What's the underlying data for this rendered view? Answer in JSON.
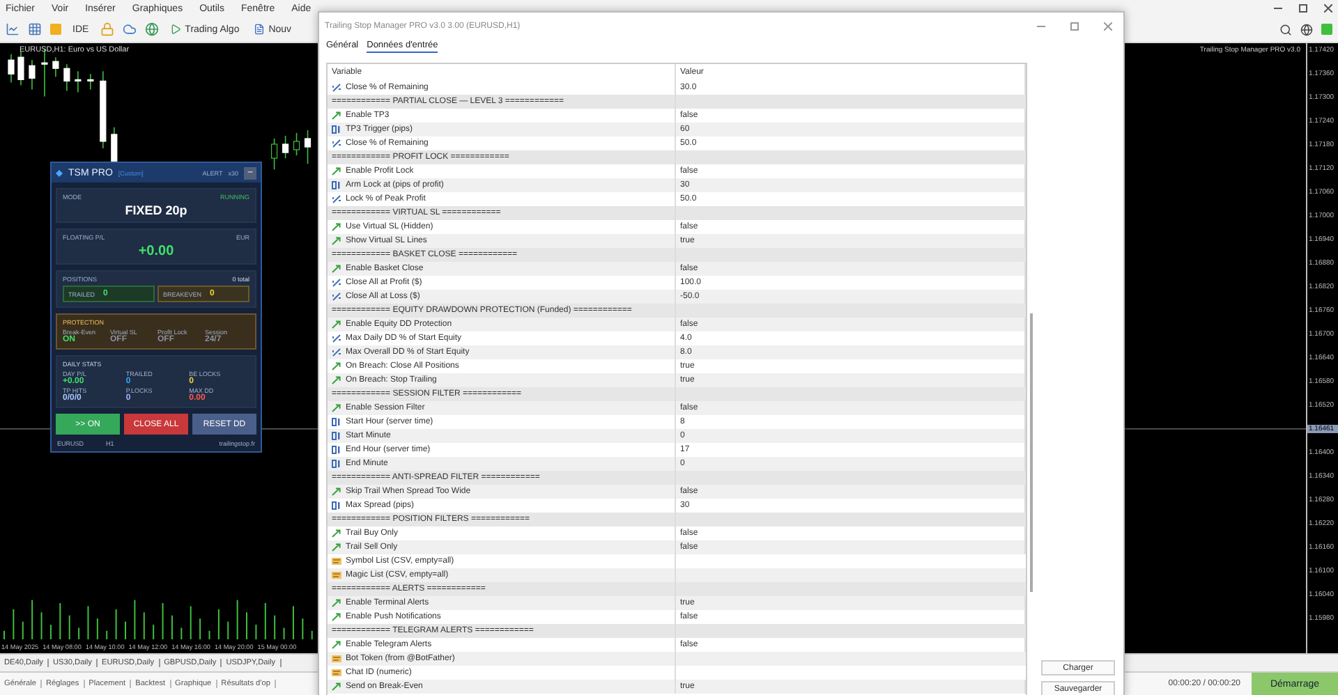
{
  "app": {
    "menu": [
      "Fichier",
      "Voir",
      "Insérer",
      "Graphiques",
      "Outils",
      "Fenêtre",
      "Aide"
    ],
    "toolbar": {
      "ide": "IDE",
      "algo": "Trading Algo",
      "new": "Nouv"
    },
    "chart": {
      "title": "EURUSD,H1: Euro vs US Dollar",
      "indicator": "Trailing Stop Manager PRO v3.0",
      "price_labels": [
        {
          "text": "1.17420",
          "current": false
        },
        {
          "text": "1.17360",
          "current": false
        },
        {
          "text": "1.17300",
          "current": false
        },
        {
          "text": "1.17240",
          "current": false
        },
        {
          "text": "1.17180",
          "current": false
        },
        {
          "text": "1.17120",
          "current": false
        },
        {
          "text": "1.17060",
          "current": false
        },
        {
          "text": "1.17000",
          "current": false
        },
        {
          "text": "1.16940",
          "current": false
        },
        {
          "text": "1.16880",
          "current": false
        },
        {
          "text": "1.16820",
          "current": false
        },
        {
          "text": "1.16760",
          "current": false
        },
        {
          "text": "1.16700",
          "current": false
        },
        {
          "text": "1.16640",
          "current": false
        },
        {
          "text": "1.16580",
          "current": false
        },
        {
          "text": "1.16520",
          "current": false
        },
        {
          "text": "1.16461",
          "current": true
        },
        {
          "text": "1.16400",
          "current": false
        },
        {
          "text": "1.16340",
          "current": false
        },
        {
          "text": "1.16280",
          "current": false
        },
        {
          "text": "1.16220",
          "current": false
        },
        {
          "text": "1.16160",
          "current": false
        },
        {
          "text": "1.16100",
          "current": false
        },
        {
          "text": "1.16040",
          "current": false
        },
        {
          "text": "1.15980",
          "current": false
        }
      ],
      "time_labels": [
        "14 May 2025",
        "14 May 08:00",
        "14 May 10:00",
        "14 May 12:00",
        "14 May 16:00",
        "14 May 20:00",
        "15 May 00:00"
      ]
    },
    "symbol_tabs": [
      "DE40,Daily",
      "US30,Daily",
      "EURUSD,Daily",
      "GBPUSD,Daily",
      "USDJPY,Daily"
    ],
    "bottom_tabs": [
      "Générale",
      "Réglages",
      "Placement",
      "Backtest",
      "Graphique",
      "Résultats d'op"
    ],
    "status": {
      "time": "00:00:20 / 00:00:20",
      "start": "Démarrage"
    }
  },
  "panel": {
    "title": "TSM PRO",
    "profile": "[Custom]",
    "alert": "ALERT",
    "multiplier": "x30",
    "minimize": "–",
    "mode": {
      "label": "MODE",
      "value": "FIXED 20p",
      "status": "RUNNING"
    },
    "floating": {
      "label": "FLOATING P/L",
      "currency": "EUR",
      "value": "+0.00"
    },
    "positions": {
      "label": "POSITIONS",
      "total": "0 total",
      "cells": [
        {
          "kind": "trailed",
          "label": "TRAILED",
          "value": "0"
        },
        {
          "kind": "breakeven",
          "label": "BREAKEVEN",
          "value": "0"
        }
      ]
    },
    "protection": {
      "label": "PROTECTION",
      "items": [
        {
          "label": "Break-Even",
          "value": "ON",
          "on": true
        },
        {
          "label": "Virtual SL",
          "value": "OFF",
          "on": false
        },
        {
          "label": "Profit Lock",
          "value": "OFF",
          "on": false
        },
        {
          "label": "Session",
          "value": "24/7",
          "on": false
        }
      ]
    },
    "daily": {
      "label": "DAILY STATS",
      "stats": [
        {
          "label": "DAY P/L",
          "value": "+0.00",
          "color": "#3ee06a"
        },
        {
          "label": "TRAILED",
          "value": "0",
          "color": "#2fa8ff"
        },
        {
          "label": "BE LOCKS",
          "value": "0",
          "color": "#f3d23a"
        },
        {
          "label": "TP HITS",
          "value": "0/0/0",
          "color": "#a8c8ff"
        },
        {
          "label": "P.LOCKS",
          "value": "0",
          "color": "#b8b0ff"
        },
        {
          "label": "MAX DD",
          "value": "0.00",
          "color": "#ff5a4a"
        }
      ]
    },
    "buttons": [
      {
        "kind": "start",
        "label": ">> ON"
      },
      {
        "kind": "close",
        "label": "CLOSE ALL"
      },
      {
        "kind": "reset",
        "label": "RESET DD"
      }
    ],
    "footer": {
      "symbol": "EURUSD",
      "timeframe": "H1",
      "site": "trailingstop.fr"
    }
  },
  "dialog": {
    "title": "Trailing Stop Manager PRO v3.0 3.00 (EURUSD,H1)",
    "tabs": [
      {
        "label": "Général",
        "selected": false
      },
      {
        "label": "Données d'entrée",
        "selected": true
      }
    ],
    "columns": [
      "Variable",
      "Valeur"
    ],
    "rows": [
      {
        "kind": "double",
        "name": "Close % of Remaining",
        "value": "30.0"
      },
      {
        "kind": "section",
        "name": "============ PARTIAL CLOSE — LEVEL 3 ============"
      },
      {
        "kind": "bool",
        "name": "Enable TP3",
        "value": "false"
      },
      {
        "kind": "int",
        "name": "TP3 Trigger (pips)",
        "value": "60"
      },
      {
        "kind": "double",
        "name": "Close % of Remaining",
        "value": "50.0"
      },
      {
        "kind": "section",
        "name": "============ PROFIT LOCK ============"
      },
      {
        "kind": "bool",
        "name": "Enable Profit Lock",
        "value": "false"
      },
      {
        "kind": "int",
        "name": "Arm Lock at (pips of profit)",
        "value": "30"
      },
      {
        "kind": "double",
        "name": "Lock % of Peak Profit",
        "value": "50.0"
      },
      {
        "kind": "section",
        "name": "============ VIRTUAL SL ============"
      },
      {
        "kind": "bool",
        "name": "Use Virtual SL (Hidden)",
        "value": "false"
      },
      {
        "kind": "bool",
        "name": "Show Virtual SL Lines",
        "value": "true"
      },
      {
        "kind": "section",
        "name": "============ BASKET CLOSE ============"
      },
      {
        "kind": "bool",
        "name": "Enable Basket Close",
        "value": "false"
      },
      {
        "kind": "double",
        "name": "Close All at Profit ($)",
        "value": "100.0"
      },
      {
        "kind": "double",
        "name": "Close All at Loss ($)",
        "value": "-50.0"
      },
      {
        "kind": "section",
        "name": "============ EQUITY DRAWDOWN PROTECTION (Funded) ============"
      },
      {
        "kind": "bool",
        "name": "Enable Equity DD Protection",
        "value": "false"
      },
      {
        "kind": "double",
        "name": "Max Daily DD % of Start Equity",
        "value": "4.0"
      },
      {
        "kind": "double",
        "name": "Max Overall DD % of Start Equity",
        "value": "8.0"
      },
      {
        "kind": "bool",
        "name": "On Breach: Close All Positions",
        "value": "true"
      },
      {
        "kind": "bool",
        "name": "On Breach: Stop Trailing",
        "value": "true"
      },
      {
        "kind": "section",
        "name": "============ SESSION FILTER ============"
      },
      {
        "kind": "bool",
        "name": "Enable Session Filter",
        "value": "false"
      },
      {
        "kind": "int",
        "name": "Start Hour (server time)",
        "value": "8"
      },
      {
        "kind": "int",
        "name": "Start Minute",
        "value": "0"
      },
      {
        "kind": "int",
        "name": "End Hour (server time)",
        "value": "17"
      },
      {
        "kind": "int",
        "name": "End Minute",
        "value": "0"
      },
      {
        "kind": "section",
        "name": "============ ANTI-SPREAD FILTER ============"
      },
      {
        "kind": "bool",
        "name": "Skip Trail When Spread Too Wide",
        "value": "false"
      },
      {
        "kind": "int",
        "name": "Max Spread (pips)",
        "value": "30"
      },
      {
        "kind": "section",
        "name": "============ POSITION FILTERS ============"
      },
      {
        "kind": "bool",
        "name": "Trail Buy Only",
        "value": "false"
      },
      {
        "kind": "bool",
        "name": "Trail Sell Only",
        "value": "false"
      },
      {
        "kind": "string",
        "name": "Symbol List (CSV, empty=all)"
      },
      {
        "kind": "string",
        "name": "Magic List (CSV, empty=all)"
      },
      {
        "kind": "section",
        "name": "============ ALERTS ============"
      },
      {
        "kind": "bool",
        "name": "Enable Terminal Alerts",
        "value": "true"
      },
      {
        "kind": "bool",
        "name": "Enable Push Notifications",
        "value": "false"
      },
      {
        "kind": "section",
        "name": "============ TELEGRAM ALERTS ============"
      },
      {
        "kind": "bool",
        "name": "Enable Telegram Alerts",
        "value": "false"
      },
      {
        "kind": "string",
        "name": "Bot Token (from @BotFather)"
      },
      {
        "kind": "string",
        "name": "Chat ID (numeric)"
      },
      {
        "kind": "bool",
        "name": "Send on Break-Even",
        "value": "true"
      }
    ],
    "buttons": [
      "Charger",
      "Sauvegarder"
    ]
  }
}
